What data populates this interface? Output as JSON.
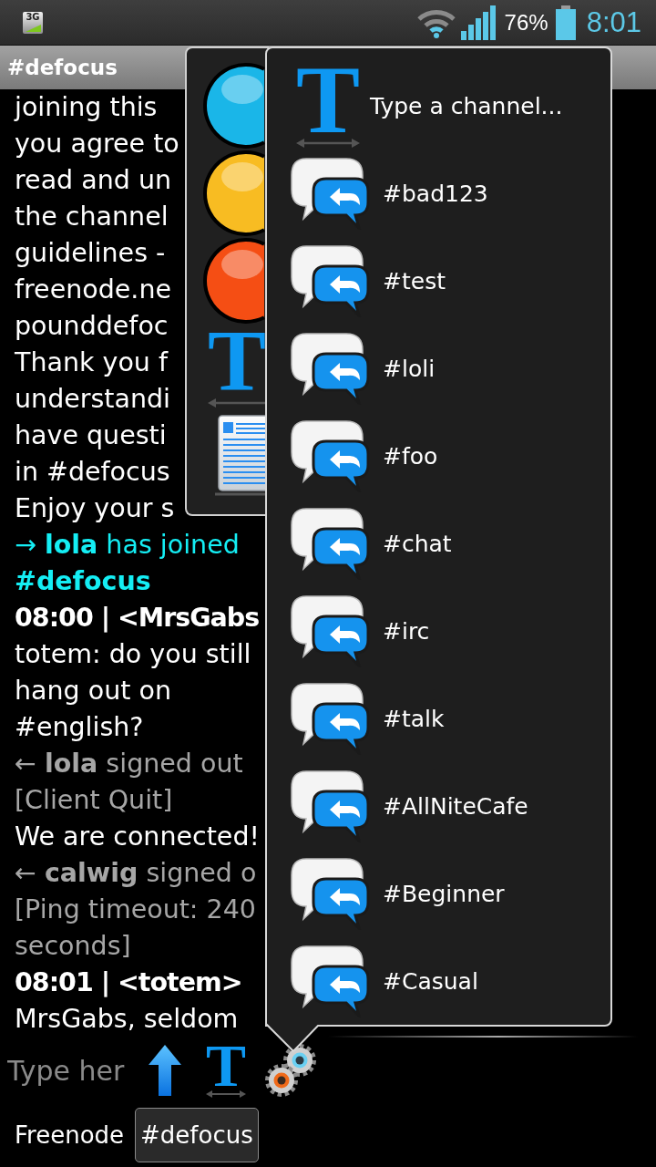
{
  "status_bar": {
    "network": "3G",
    "battery": "76%",
    "time": "8:01"
  },
  "title_bar": {
    "title": "#defocus"
  },
  "chat": {
    "lines": [
      {
        "kind": "text",
        "text": "joining this"
      },
      {
        "kind": "text",
        "text": "you agree to"
      },
      {
        "kind": "text",
        "text": "read and un"
      },
      {
        "kind": "text",
        "text": "the channel"
      },
      {
        "kind": "text",
        "text": "guidelines -"
      },
      {
        "kind": "text",
        "text": "freenode.ne"
      },
      {
        "kind": "text",
        "text": "pounddefoc"
      },
      {
        "kind": "text",
        "text": "Thank you f"
      },
      {
        "kind": "text",
        "text": "understandi"
      },
      {
        "kind": "text",
        "text": "have questi"
      },
      {
        "kind": "text",
        "text": "in #defocus"
      },
      {
        "kind": "text",
        "text": "Enjoy your s"
      },
      {
        "kind": "join",
        "text": "→ **lola** has joined"
      },
      {
        "kind": "channel",
        "text": "#defocus"
      },
      {
        "kind": "header",
        "text": "08:00 | <MrsGabs"
      },
      {
        "kind": "text",
        "text": "totem: do you still"
      },
      {
        "kind": "text",
        "text": "hang out on"
      },
      {
        "kind": "text",
        "text": "#english?"
      },
      {
        "kind": "quit",
        "text": "← **lola** signed out"
      },
      {
        "kind": "quit",
        "text": "[Client Quit]"
      },
      {
        "kind": "text",
        "text": "We are connected!"
      },
      {
        "kind": "quit",
        "text": "← **calwig** signed o"
      },
      {
        "kind": "quit",
        "text": "[Ping timeout: 240"
      },
      {
        "kind": "quit",
        "text": "seconds]"
      },
      {
        "kind": "header",
        "text": "08:01 | <totem>"
      },
      {
        "kind": "text",
        "text": "MrsGabs, seldom"
      }
    ]
  },
  "tools_menu": {
    "items": [
      {
        "kind": "color",
        "color": "#1ab6e8"
      },
      {
        "kind": "color",
        "color": "#f8bc22"
      },
      {
        "kind": "color",
        "color": "#f54e14"
      },
      {
        "kind": "typeface",
        "glyph": "T"
      },
      {
        "kind": "document"
      }
    ]
  },
  "channel_menu": {
    "items": [
      {
        "kind": "custom",
        "glyph": "T",
        "label": "Type a channel..."
      },
      {
        "kind": "channel",
        "label": "#bad123"
      },
      {
        "kind": "channel",
        "label": "#test"
      },
      {
        "kind": "channel",
        "label": "#loli"
      },
      {
        "kind": "channel",
        "label": "#foo"
      },
      {
        "kind": "channel",
        "label": "#chat"
      },
      {
        "kind": "channel",
        "label": "#irc"
      },
      {
        "kind": "channel",
        "label": "#talk"
      },
      {
        "kind": "channel",
        "label": "#AllNiteCafe"
      },
      {
        "kind": "channel",
        "label": "#Beginner"
      },
      {
        "kind": "channel",
        "label": "#Casual"
      }
    ]
  },
  "input_bar": {
    "placeholder": "Type her",
    "format_glyph": "T"
  },
  "tabs": [
    {
      "label": "Freenode",
      "selected": false
    },
    {
      "label": "#defocus",
      "selected": true
    }
  ]
}
